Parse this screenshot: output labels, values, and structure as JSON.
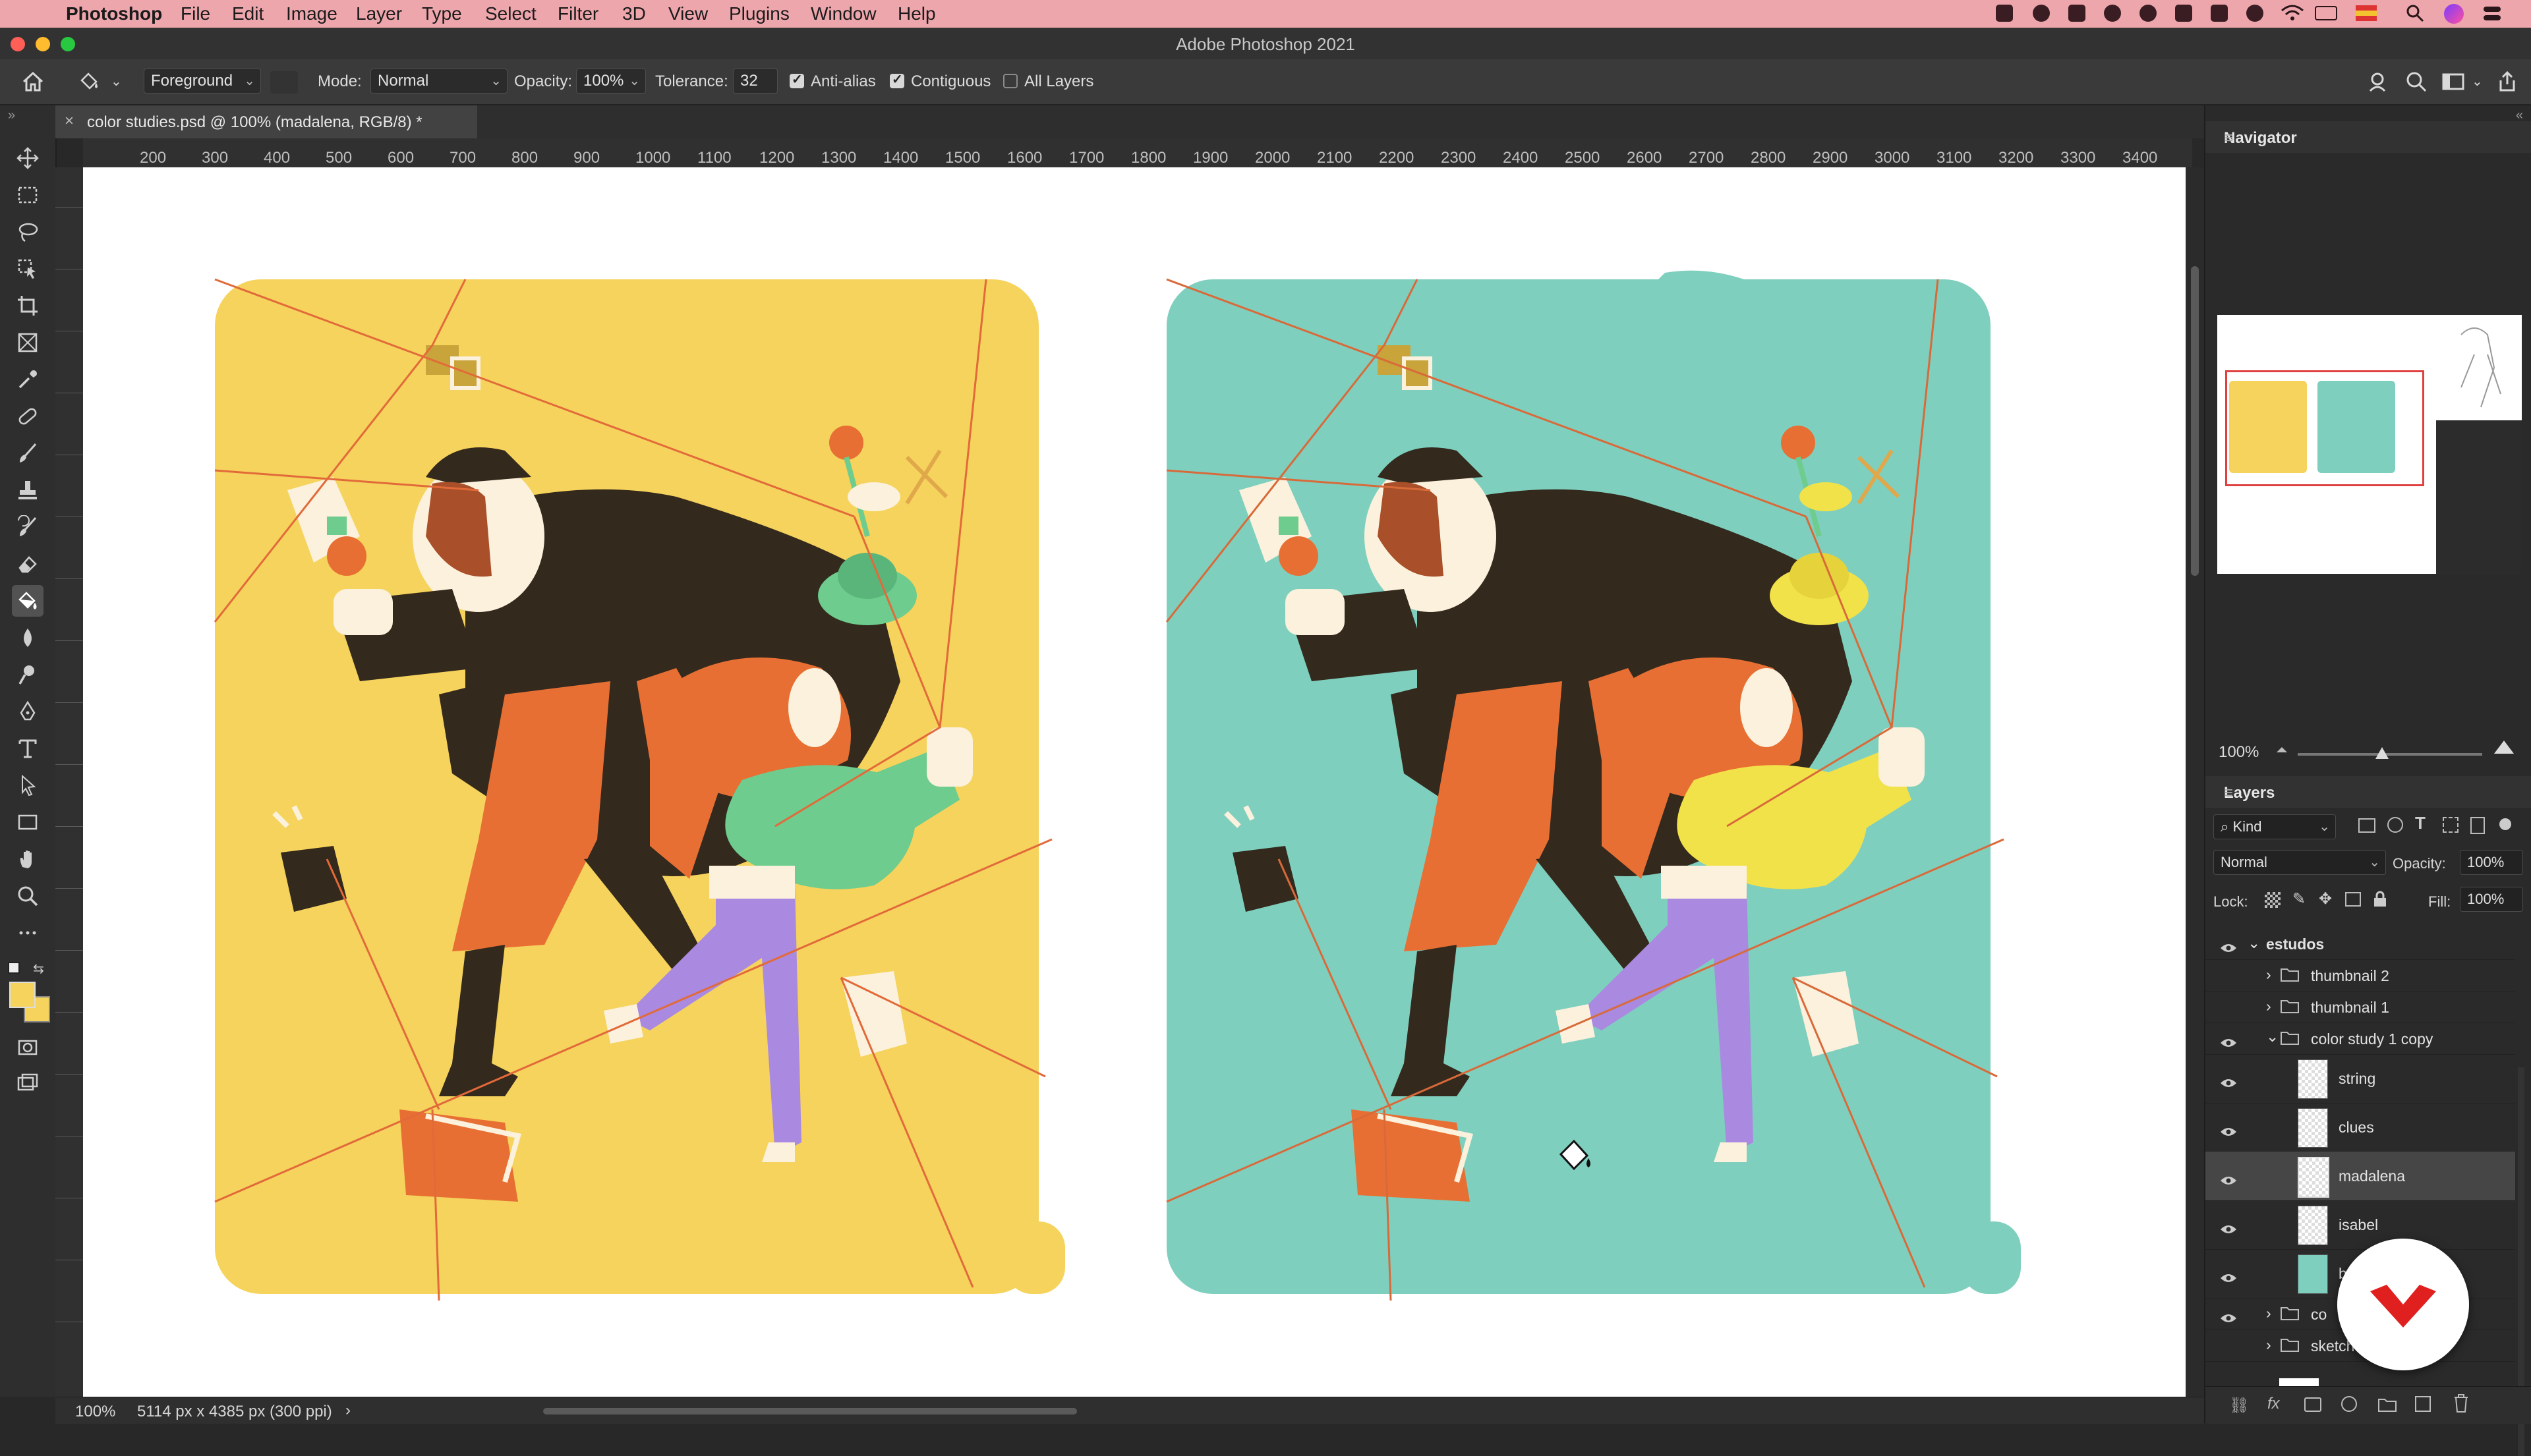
{
  "menubar": {
    "apple": "",
    "app": "Photoshop",
    "items": [
      "File",
      "Edit",
      "Image",
      "Layer",
      "Type",
      "Select",
      "Filter",
      "3D",
      "View",
      "Plugins",
      "Window",
      "Help"
    ]
  },
  "window": {
    "title": "Adobe Photoshop 2021"
  },
  "options": {
    "fill_source": "Foreground",
    "mode_label": "Mode:",
    "mode_value": "Normal",
    "opacity_label": "Opacity:",
    "opacity_value": "100%",
    "tolerance_label": "Tolerance:",
    "tolerance_value": "32",
    "anti_alias": "Anti-alias",
    "contiguous": "Contiguous",
    "all_layers": "All Layers"
  },
  "document": {
    "tab_label": "color studies.psd @ 100% (madalena, RGB/8) *"
  },
  "ruler": {
    "labels": [
      "200",
      "300",
      "400",
      "500",
      "600",
      "700",
      "800",
      "900",
      "1000",
      "1100",
      "1200",
      "1300",
      "1400",
      "1500",
      "1600",
      "1700",
      "1800",
      "1900",
      "2000",
      "2100",
      "2200",
      "2300",
      "2400",
      "2500",
      "2600",
      "2700",
      "2800",
      "2900",
      "3000",
      "3100",
      "3200",
      "3300",
      "3400"
    ]
  },
  "status": {
    "zoom": "100%",
    "doc_info": "5114 px x 4385 px (300 ppi)",
    "arrow": "›"
  },
  "navigator": {
    "title": "Navigator",
    "zoom": "100%"
  },
  "layers": {
    "title": "Layers",
    "filter_kind": "Kind",
    "blend_mode": "Normal",
    "opacity_label": "Opacity:",
    "opacity_value": "100%",
    "lock_label": "Lock:",
    "fill_label": "Fill:",
    "fill_value": "100%",
    "group_root": "estudos",
    "rows": [
      {
        "name": "thumbnail 2"
      },
      {
        "name": "thumbnail 1"
      },
      {
        "name": "color study 1 copy"
      },
      {
        "name": "string"
      },
      {
        "name": "clues"
      },
      {
        "name": "madalena"
      },
      {
        "name": "isabel"
      },
      {
        "name": "b"
      },
      {
        "name": "co"
      },
      {
        "name": "sketch"
      }
    ]
  },
  "colors": {
    "yellow_bg": "#f5d35c",
    "teal_bg": "#7fcfbe",
    "orange": "#e86f33",
    "dark": "#34291d",
    "purple": "#a98ae0",
    "green": "#6dcc8e",
    "lemon": "#f2e24a",
    "cream": "#fbf1dc",
    "string": "#e26a3a",
    "ps_blue": "#31a8ff"
  }
}
